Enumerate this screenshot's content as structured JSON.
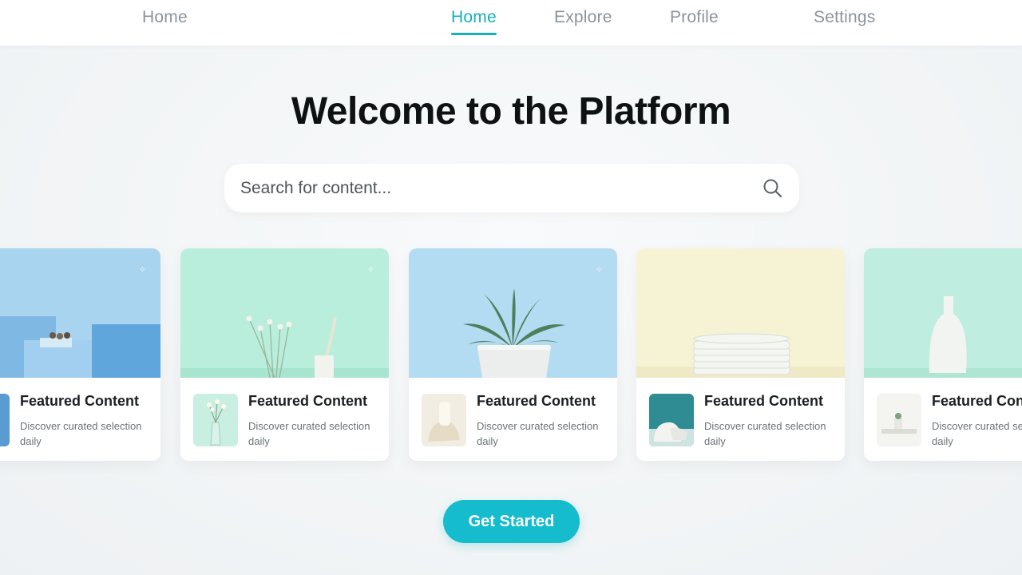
{
  "nav": {
    "brand": "Home",
    "items": [
      {
        "label": "Home",
        "active": true
      },
      {
        "label": "Explore",
        "active": false
      },
      {
        "label": "Profile",
        "active": false
      },
      {
        "label": "Settings",
        "active": false
      }
    ]
  },
  "hero": {
    "title": "Welcome to the Platform"
  },
  "search": {
    "placeholder": "Search for content...",
    "icon": "search-icon"
  },
  "cards": [
    {
      "title": "Featured Content",
      "description": "Discover curated selection daily",
      "image": "blue-steps-scene",
      "bg": "#a9d4ef"
    },
    {
      "title": "Featured Content",
      "description": "Discover curated selection daily",
      "image": "dried-flowers-vase-scene",
      "bg": "#b9eedd"
    },
    {
      "title": "Featured Content",
      "description": "Discover curated selection daily",
      "image": "potted-palm-scene",
      "bg": "#b3dbf1"
    },
    {
      "title": "Featured Content",
      "description": "Discover curated selection daily",
      "image": "stacked-plates-scene",
      "bg": "#f6f3d4"
    },
    {
      "title": "Featured Content",
      "description": "Discover curated selection daily",
      "image": "white-vase-scene",
      "bg": "#bfeee0"
    }
  ],
  "cta": {
    "label": "Get Started"
  },
  "colors": {
    "accent": "#17aebe",
    "cta": "#14bccd",
    "nav_inactive": "#8a949c"
  }
}
